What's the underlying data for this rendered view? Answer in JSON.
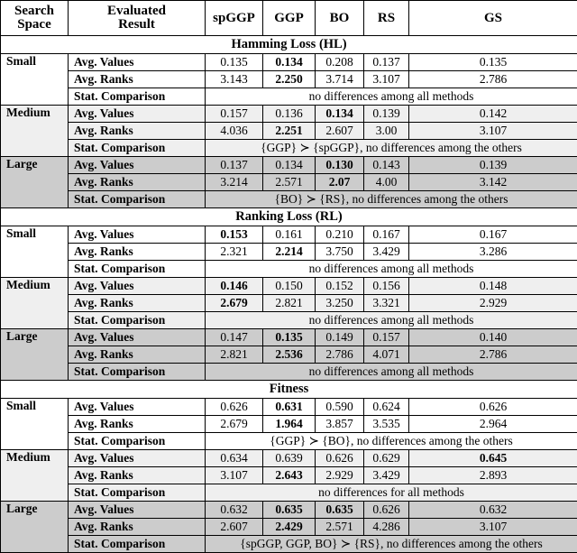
{
  "table": {
    "headers": {
      "search_space_line1": "Search",
      "search_space_line2": "Space",
      "evaluated_line1": "Evaluated",
      "evaluated_line2": "Result",
      "spggp": "spGGP",
      "ggp": "GGP",
      "bo": "BO",
      "rs": "RS",
      "gs": "GS"
    },
    "row_labels": {
      "avg_values": "Avg. Values",
      "avg_ranks": "Avg. Ranks",
      "stat_comparison": "Stat. Comparison"
    },
    "spaces": {
      "small": "Small",
      "medium": "Medium",
      "large": "Large"
    },
    "sections": [
      {
        "title": "Hamming Loss (HL)",
        "groups": [
          {
            "space": "Small",
            "shade": "none",
            "avg_values": [
              "0.135",
              "0.134",
              "0.208",
              "0.137",
              "0.135"
            ],
            "avg_values_bold": [
              false,
              true,
              false,
              false,
              false
            ],
            "avg_ranks": [
              "3.143",
              "2.250",
              "3.714",
              "3.107",
              "2.786"
            ],
            "avg_ranks_bold": [
              false,
              true,
              false,
              false,
              false
            ],
            "stat": "no differences among all methods"
          },
          {
            "space": "Medium",
            "shade": "light",
            "avg_values": [
              "0.157",
              "0.136",
              "0.134",
              "0.139",
              "0.142"
            ],
            "avg_values_bold": [
              false,
              false,
              true,
              false,
              false
            ],
            "avg_ranks": [
              "4.036",
              "2.251",
              "2.607",
              "3.00",
              "3.107"
            ],
            "avg_ranks_bold": [
              false,
              true,
              false,
              false,
              false
            ],
            "stat": "{GGP} ≻ {spGGP}, no differences among the others"
          },
          {
            "space": "Large",
            "shade": "dark",
            "avg_values": [
              "0.137",
              "0.134",
              "0.130",
              "0.143",
              "0.139"
            ],
            "avg_values_bold": [
              false,
              false,
              true,
              false,
              false
            ],
            "avg_ranks": [
              "3.214",
              "2.571",
              "2.07",
              "4.00",
              "3.142"
            ],
            "avg_ranks_bold": [
              false,
              false,
              true,
              false,
              false
            ],
            "stat": "{BO} ≻ {RS}, no differences among the others"
          }
        ]
      },
      {
        "title": "Ranking Loss (RL)",
        "groups": [
          {
            "space": "Small",
            "shade": "none",
            "avg_values": [
              "0.153",
              "0.161",
              "0.210",
              "0.167",
              "0.167"
            ],
            "avg_values_bold": [
              true,
              false,
              false,
              false,
              false
            ],
            "avg_ranks": [
              "2.321",
              "2.214",
              "3.750",
              "3.429",
              "3.286"
            ],
            "avg_ranks_bold": [
              false,
              true,
              false,
              false,
              false
            ],
            "stat": "no differences among all methods"
          },
          {
            "space": "Medium",
            "shade": "light",
            "avg_values": [
              "0.146",
              "0.150",
              "0.152",
              "0.156",
              "0.148"
            ],
            "avg_values_bold": [
              true,
              false,
              false,
              false,
              false
            ],
            "avg_ranks": [
              "2.679",
              "2.821",
              "3.250",
              "3.321",
              "2.929"
            ],
            "avg_ranks_bold": [
              true,
              false,
              false,
              false,
              false
            ],
            "stat": "no differences among all methods"
          },
          {
            "space": "Large",
            "shade": "dark",
            "avg_values": [
              "0.147",
              "0.135",
              "0.149",
              "0.157",
              "0.140"
            ],
            "avg_values_bold": [
              false,
              true,
              false,
              false,
              false
            ],
            "avg_ranks": [
              "2.821",
              "2.536",
              "2.786",
              "4.071",
              "2.786"
            ],
            "avg_ranks_bold": [
              false,
              true,
              false,
              false,
              false
            ],
            "stat": "no differences among all methods"
          }
        ]
      },
      {
        "title": "Fitness",
        "groups": [
          {
            "space": "Small",
            "shade": "none",
            "avg_values": [
              "0.626",
              "0.631",
              "0.590",
              "0.624",
              "0.626"
            ],
            "avg_values_bold": [
              false,
              true,
              false,
              false,
              false
            ],
            "avg_ranks": [
              "2.679",
              "1.964",
              "3.857",
              "3.535",
              "2.964"
            ],
            "avg_ranks_bold": [
              false,
              true,
              false,
              false,
              false
            ],
            "stat": "{GGP} ≻ {BO}, no differences among the others"
          },
          {
            "space": "Medium",
            "shade": "light",
            "avg_values": [
              "0.634",
              "0.639",
              "0.626",
              "0.629",
              "0.645"
            ],
            "avg_values_bold": [
              false,
              false,
              false,
              false,
              true
            ],
            "avg_ranks": [
              "3.107",
              "2.643",
              "2.929",
              "3.429",
              "2.893"
            ],
            "avg_ranks_bold": [
              false,
              true,
              false,
              false,
              false
            ],
            "stat": "no differences for all methods"
          },
          {
            "space": "Large",
            "shade": "dark",
            "avg_values": [
              "0.632",
              "0.635",
              "0.635",
              "0.626",
              "0.632"
            ],
            "avg_values_bold": [
              false,
              true,
              true,
              false,
              false
            ],
            "avg_ranks": [
              "2.607",
              "2.429",
              "2.571",
              "4.286",
              "3.107"
            ],
            "avg_ranks_bold": [
              false,
              true,
              false,
              false,
              false
            ],
            "stat": "{spGGP, GGP, BO} ≻ {RS}, no differences among the others"
          }
        ]
      }
    ]
  }
}
